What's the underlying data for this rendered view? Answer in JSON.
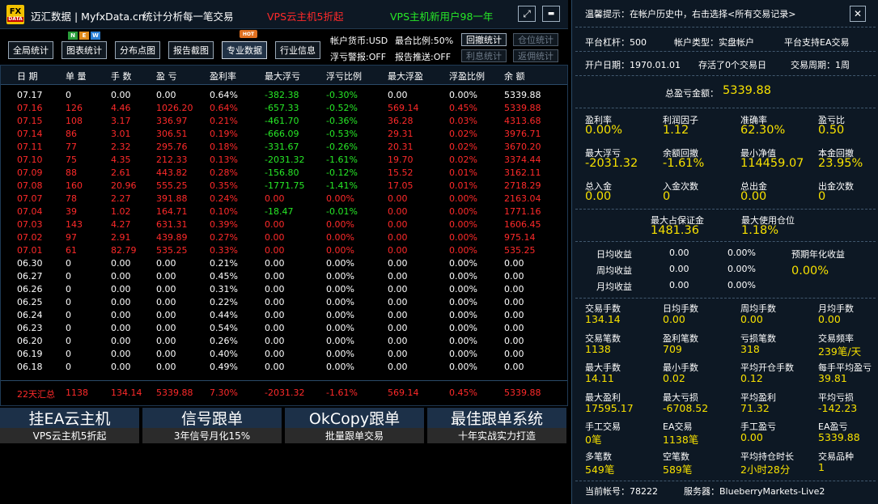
{
  "title_bar": {
    "logo_top": "FX",
    "logo_bottom": "DATA",
    "app_name": "迈汇数据 | MyfxData.cn",
    "slogan": "统计分析每一笔交易",
    "promo_red": "VPS云主机5折起",
    "promo_green": "VPS主机新用户98一年",
    "resize_glyph": "⤢",
    "min_glyph": "▬"
  },
  "toolbar": {
    "buttons": [
      "全局统计",
      "图表统计",
      "分布点图",
      "报告截图",
      "专业数据",
      "行业信息"
    ],
    "badge_n": "N",
    "badge_e": "E",
    "badge_w": "W",
    "hot": "HOT",
    "currency": "帐户货币:USD",
    "best_ratio": "最合比例:50%",
    "float_alert": "浮亏警报:OFF",
    "report_push": "报告推送:OFF",
    "btn_drawdown": "回撤统计",
    "btn_position": "仓位统计",
    "btn_interest": "利息统计",
    "btn_rebate": "返佣统计"
  },
  "table": {
    "headers": [
      "日 期",
      "单 量",
      "手 数",
      "盈 亏",
      "盈利率",
      "最大浮亏",
      "浮亏比例",
      "最大浮盈",
      "浮盈比例",
      "余 额"
    ],
    "rows": [
      [
        "07.17",
        "0",
        "0.00",
        "0.00",
        "0.64%",
        "-382.38",
        "-0.30%",
        "0.00",
        "0.00%",
        "5339.88"
      ],
      [
        "07.16",
        "126",
        "4.46",
        "1026.20",
        "0.64%",
        "-657.33",
        "-0.52%",
        "569.14",
        "0.45%",
        "5339.88"
      ],
      [
        "07.15",
        "108",
        "3.17",
        "336.97",
        "0.21%",
        "-461.70",
        "-0.36%",
        "36.28",
        "0.03%",
        "4313.68"
      ],
      [
        "07.14",
        "86",
        "3.01",
        "306.51",
        "0.19%",
        "-666.09",
        "-0.53%",
        "29.31",
        "0.02%",
        "3976.71"
      ],
      [
        "07.11",
        "77",
        "2.32",
        "295.76",
        "0.18%",
        "-331.67",
        "-0.26%",
        "20.31",
        "0.02%",
        "3670.20"
      ],
      [
        "07.10",
        "75",
        "4.35",
        "212.33",
        "0.13%",
        "-2031.32",
        "-1.61%",
        "19.70",
        "0.02%",
        "3374.44"
      ],
      [
        "07.09",
        "88",
        "2.61",
        "443.82",
        "0.28%",
        "-156.80",
        "-0.12%",
        "15.52",
        "0.01%",
        "3162.11"
      ],
      [
        "07.08",
        "160",
        "20.96",
        "555.25",
        "0.35%",
        "-1771.75",
        "-1.41%",
        "17.05",
        "0.01%",
        "2718.29"
      ],
      [
        "07.07",
        "78",
        "2.27",
        "391.88",
        "0.24%",
        "0.00",
        "0.00%",
        "0.00",
        "0.00%",
        "2163.04"
      ],
      [
        "07.04",
        "39",
        "1.02",
        "164.71",
        "0.10%",
        "-18.47",
        "-0.01%",
        "0.00",
        "0.00%",
        "1771.16"
      ],
      [
        "07.03",
        "143",
        "4.27",
        "631.31",
        "0.39%",
        "0.00",
        "0.00%",
        "0.00",
        "0.00%",
        "1606.45"
      ],
      [
        "07.02",
        "97",
        "2.91",
        "439.89",
        "0.27%",
        "0.00",
        "0.00%",
        "0.00",
        "0.00%",
        "975.14"
      ],
      [
        "07.01",
        "61",
        "82.79",
        "535.25",
        "0.33%",
        "0.00",
        "0.00%",
        "0.00",
        "0.00%",
        "535.25"
      ],
      [
        "06.30",
        "0",
        "0.00",
        "0.00",
        "0.21%",
        "0.00",
        "0.00%",
        "0.00",
        "0.00%",
        "0.00"
      ],
      [
        "06.27",
        "0",
        "0.00",
        "0.00",
        "0.45%",
        "0.00",
        "0.00%",
        "0.00",
        "0.00%",
        "0.00"
      ],
      [
        "06.26",
        "0",
        "0.00",
        "0.00",
        "0.31%",
        "0.00",
        "0.00%",
        "0.00",
        "0.00%",
        "0.00"
      ],
      [
        "06.25",
        "0",
        "0.00",
        "0.00",
        "0.22%",
        "0.00",
        "0.00%",
        "0.00",
        "0.00%",
        "0.00"
      ],
      [
        "06.24",
        "0",
        "0.00",
        "0.00",
        "0.44%",
        "0.00",
        "0.00%",
        "0.00",
        "0.00%",
        "0.00"
      ],
      [
        "06.23",
        "0",
        "0.00",
        "0.00",
        "0.54%",
        "0.00",
        "0.00%",
        "0.00",
        "0.00%",
        "0.00"
      ],
      [
        "06.20",
        "0",
        "0.00",
        "0.00",
        "0.26%",
        "0.00",
        "0.00%",
        "0.00",
        "0.00%",
        "0.00"
      ],
      [
        "06.19",
        "0",
        "0.00",
        "0.00",
        "0.40%",
        "0.00",
        "0.00%",
        "0.00",
        "0.00%",
        "0.00"
      ],
      [
        "06.18",
        "0",
        "0.00",
        "0.00",
        "0.49%",
        "0.00",
        "0.00%",
        "0.00",
        "0.00%",
        "0.00"
      ]
    ],
    "row_colors": [
      "white",
      "red",
      "red",
      "red",
      "red",
      "red",
      "red",
      "red",
      "red",
      "red",
      "red",
      "red",
      "red",
      "white",
      "white",
      "white",
      "white",
      "white",
      "white",
      "white",
      "white",
      "white"
    ],
    "summary": [
      "22天汇总",
      "1138",
      "134.14",
      "5339.88",
      "7.30%",
      "-2031.32",
      "-1.61%",
      "569.14",
      "0.45%",
      "5339.88"
    ]
  },
  "ads": [
    {
      "title": "挂EA云主机",
      "sub": "VPS云主机5折起"
    },
    {
      "title": "信号跟单",
      "sub": "3年信号月化15%"
    },
    {
      "title": "OkCopy跟单",
      "sub": "批量跟单交易"
    },
    {
      "title": "最佳跟单系统",
      "sub": "十年实战实力打造"
    }
  ],
  "panel": {
    "tip": "温馨提示：在帐户历史中，右击选择<所有交易记录>",
    "close_glyph": "✕",
    "leverage": "平台杠杆：500",
    "account_type": "帐户类型：实盘帐户",
    "ea_support": "平台支持EA交易",
    "open_date": "开户日期：1970.01.01",
    "stored": "存活了0个交易日",
    "period": "交易周期：1周",
    "total_label": "总盈亏金额：",
    "total_value": "5339.88",
    "grid1": [
      [
        "盈利率",
        "0.00%"
      ],
      [
        "利润因子",
        "1.12"
      ],
      [
        "准确率",
        "62.30%"
      ],
      [
        "盈亏比",
        "0.50"
      ],
      [
        "最大浮亏",
        "-2031.32"
      ],
      [
        "余额回撤",
        "-1.61%"
      ],
      [
        "最小净值",
        "114459.07"
      ],
      [
        "本金回撤",
        "23.95%"
      ],
      [
        "总入金",
        "0.00"
      ],
      [
        "入金次数",
        "0"
      ],
      [
        "总出金",
        "0.00"
      ],
      [
        "出金次数",
        "0"
      ]
    ],
    "margin_label": "最大占保证金",
    "margin_value": "1481.36",
    "pos_label": "最大使用仓位",
    "pos_value": "1.18%",
    "income": [
      [
        "日均收益",
        "0.00",
        "0.00%"
      ],
      [
        "周均收益",
        "0.00",
        "0.00%"
      ],
      [
        "月均收益",
        "0.00",
        "0.00%"
      ]
    ],
    "annual_label": "预期年化收益",
    "annual_value": "0.00%",
    "grid2": [
      [
        "交易手数",
        "134.14"
      ],
      [
        "日均手数",
        "0.00"
      ],
      [
        "周均手数",
        "0.00"
      ],
      [
        "月均手数",
        "0.00"
      ],
      [
        "交易笔数",
        "1138"
      ],
      [
        "盈利笔数",
        "709"
      ],
      [
        "亏损笔数",
        "318"
      ],
      [
        "交易频率",
        "239笔/天"
      ],
      [
        "最大手数",
        "14.11"
      ],
      [
        "最小手数",
        "0.02"
      ],
      [
        "平均开仓手数",
        "0.12"
      ],
      [
        "每手平均盈亏",
        "39.81"
      ],
      [
        "最大盈利",
        "17595.17"
      ],
      [
        "最大亏损",
        "-6708.52"
      ],
      [
        "平均盈利",
        "71.32"
      ],
      [
        "平均亏损",
        "-142.23"
      ],
      [
        "手工交易",
        "0笔"
      ],
      [
        "EA交易",
        "1138笔"
      ],
      [
        "手工盈亏",
        "0.00"
      ],
      [
        "EA盈亏",
        "5339.88"
      ],
      [
        "多笔数",
        "549笔"
      ],
      [
        "空笔数",
        "589笔"
      ],
      [
        "平均持仓时长",
        "2小时28分"
      ],
      [
        "交易品种",
        "1"
      ]
    ],
    "account": "当前帐号：78222",
    "server": "服务器：BlueberryMarkets-Live2"
  },
  "colors": {
    "red": "#ff2a2a",
    "green": "#27e827",
    "yellow": "#f6e000",
    "white": "#ffffff",
    "panel_bg": "#0d1824"
  }
}
